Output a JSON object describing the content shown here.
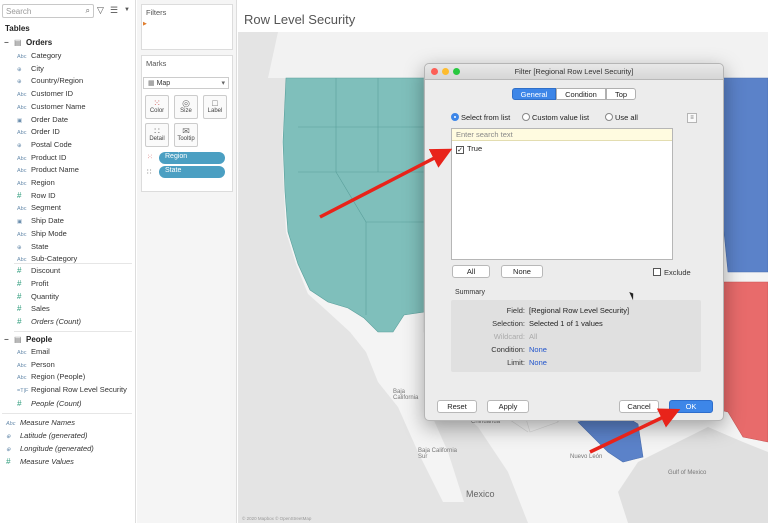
{
  "data_pane": {
    "search_placeholder": "Search",
    "tables_heading": "Tables",
    "orders": {
      "name": "Orders",
      "fields": [
        {
          "type": "Abc",
          "name": "Category"
        },
        {
          "type": "⊕",
          "name": "City"
        },
        {
          "type": "⊕",
          "name": "Country/Region"
        },
        {
          "type": "Abc",
          "name": "Customer ID"
        },
        {
          "type": "Abc",
          "name": "Customer Name"
        },
        {
          "type": "▣",
          "name": "Order Date"
        },
        {
          "type": "Abc",
          "name": "Order ID"
        },
        {
          "type": "⊕",
          "name": "Postal Code"
        },
        {
          "type": "Abc",
          "name": "Product ID"
        },
        {
          "type": "Abc",
          "name": "Product Name"
        },
        {
          "type": "Abc",
          "name": "Region"
        },
        {
          "type": "#",
          "name": "Row ID"
        },
        {
          "type": "Abc",
          "name": "Segment"
        },
        {
          "type": "▣",
          "name": "Ship Date"
        },
        {
          "type": "Abc",
          "name": "Ship Mode"
        },
        {
          "type": "⊕",
          "name": "State"
        },
        {
          "type": "Abc",
          "name": "Sub-Category"
        }
      ],
      "measures": [
        {
          "type": "#",
          "name": "Discount"
        },
        {
          "type": "#",
          "name": "Profit"
        },
        {
          "type": "#",
          "name": "Quantity"
        },
        {
          "type": "#",
          "name": "Sales"
        },
        {
          "type": "#",
          "name": "Orders (Count)"
        }
      ]
    },
    "people": {
      "name": "People",
      "fields": [
        {
          "type": "Abc",
          "name": "Email"
        },
        {
          "type": "Abc",
          "name": "Person"
        },
        {
          "type": "Abc",
          "name": "Region (People)"
        },
        {
          "type": "=T|F",
          "name": "Regional Row Level Security"
        }
      ],
      "measures": [
        {
          "type": "#",
          "name": "People (Count)"
        }
      ]
    },
    "extras": [
      {
        "type": "Abc",
        "name": "Measure Names"
      },
      {
        "type": "⊕",
        "name": "Latitude (generated)"
      },
      {
        "type": "⊕",
        "name": "Longitude (generated)"
      },
      {
        "type": "#",
        "name": "Measure Values"
      }
    ]
  },
  "shelves": {
    "filters_title": "Filters",
    "marks_title": "Marks",
    "mark_type": "Map",
    "mark_buttons": [
      "Color",
      "Size",
      "Label",
      "Detail",
      "Tooltip"
    ],
    "pills": [
      "Region",
      "State"
    ]
  },
  "sheet": {
    "title": "Row Level Security",
    "map_labels": {
      "baja_california": "Baja\nCalifornia",
      "chihuahua": "Chihuahua",
      "baja_california_sur": "Baja California\nSur",
      "nuevo_leon": "Nuevo León",
      "mexico": "Mexico",
      "gulf": "Gulf of Mexico"
    },
    "copyright": "© 2020 Mapbox © OpenStreetMap"
  },
  "dialog": {
    "title": "Filter [Regional Row Level Security]",
    "tabs": [
      "General",
      "Condition",
      "Top"
    ],
    "active_tab": "General",
    "radio_options": [
      "Select from list",
      "Custom value list",
      "Use all"
    ],
    "search_placeholder": "Enter search text",
    "items": [
      {
        "label": "True",
        "checked": "✓"
      }
    ],
    "all_button": "All",
    "none_button": "None",
    "exclude_label": "Exclude",
    "summary_heading": "Summary",
    "summary": {
      "field_key": "Field:",
      "field_val": "[Regional Row Level Security]",
      "selection_key": "Selection:",
      "selection_val": "Selected 1 of 1 values",
      "wildcard_key": "Wildcard:",
      "wildcard_val": "All",
      "condition_key": "Condition:",
      "condition_val": "None",
      "limit_key": "Limit:",
      "limit_val": "None"
    },
    "reset_button": "Reset",
    "apply_button": "Apply",
    "cancel_button": "Cancel",
    "ok_button": "OK"
  },
  "colors": {
    "west_region": "#7fbfbb",
    "east_region": "#5b82c9",
    "south_region": "#e86b6b",
    "annotation_arrow": "#e8231a",
    "accent": "#3d86e8"
  }
}
